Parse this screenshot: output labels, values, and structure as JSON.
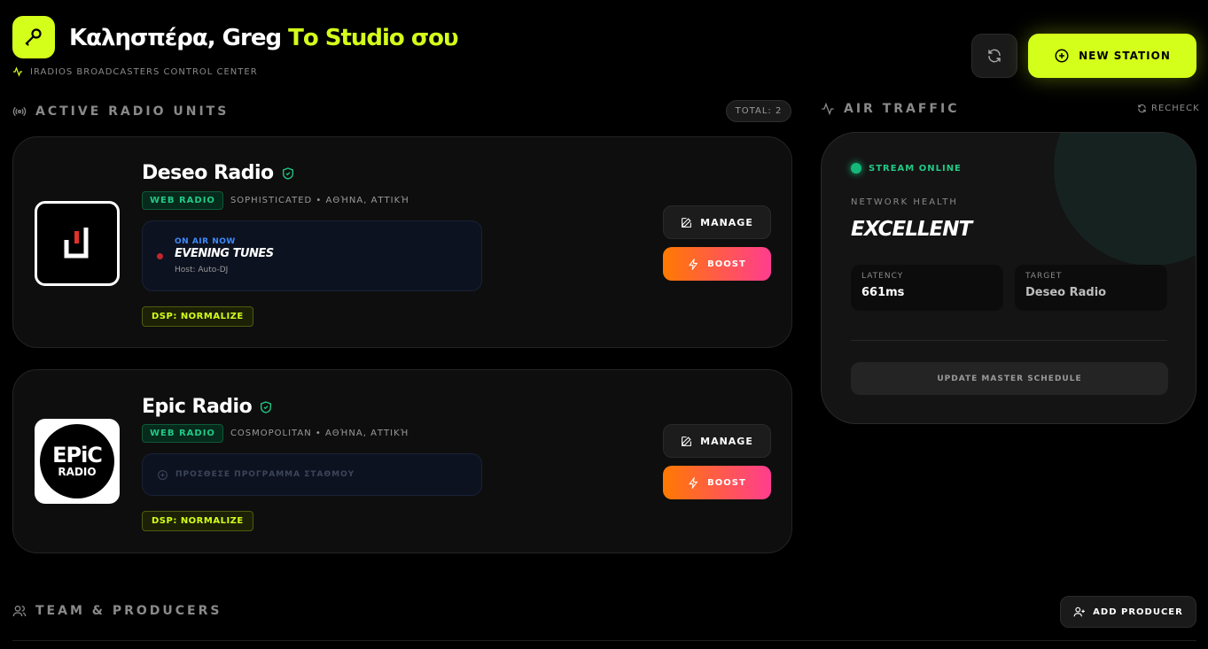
{
  "header": {
    "greeting": "Καλησπέρα, Greg",
    "studio": "Το Studio σου",
    "subtitle": "IRADIOS BROADCASTERS CONTROL CENTER",
    "new_station_label": "NEW STATION",
    "accent": "#d4ff1a"
  },
  "units": {
    "title": "ACTIVE RADIO UNITS",
    "total": "TOTAL: 2"
  },
  "stations": [
    {
      "name": "Deseo Radio",
      "type": "WEB RADIO",
      "meta": "SOPHISTICATED • ΑΘΉΝΑ, ΑΤΤΙΚΉ",
      "onair_label": "ON AIR NOW",
      "show": "EVENING TUNES",
      "host": "Host: Auto-DJ",
      "dsp": "DSP: NORMALIZE",
      "manage": "MANAGE",
      "boost": "BOOST"
    },
    {
      "name": "Epic Radio",
      "type": "WEB RADIO",
      "meta": "COSMOPOLITAN • ΑΘΉΝΑ, ΑΤΤΙΚΉ",
      "add_program": "ΠΡΟΣΘΕΣΕ ΠΡΟΓΡΑΜΜΑ ΣΤΑΘΜΟΥ",
      "dsp": "DSP: NORMALIZE",
      "manage": "MANAGE",
      "boost": "BOOST",
      "logo_top": "EPiC",
      "logo_bottom": "RADIO"
    }
  ],
  "traffic": {
    "title": "AIR TRAFFIC",
    "recheck": "RECHECK",
    "stream_status": "STREAM ONLINE",
    "health_label": "NETWORK HEALTH",
    "health_value": "EXCELLENT",
    "latency_label": "LATENCY",
    "latency_value": "661ms",
    "target_label": "TARGET",
    "target_value": "Deseo Radio",
    "update_label": "UPDATE MASTER SCHEDULE"
  },
  "team": {
    "title": "TEAM & PRODUCERS",
    "add_label": "ADD PRODUCER"
  }
}
